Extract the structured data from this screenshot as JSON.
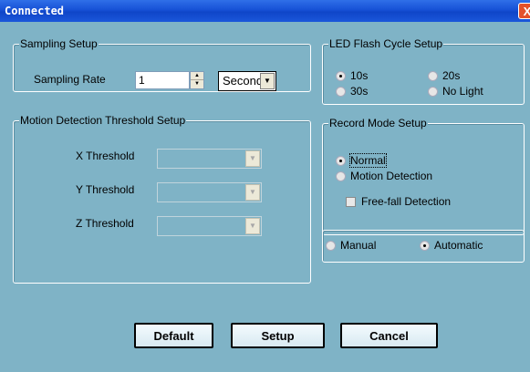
{
  "window": {
    "title": "Connected",
    "close_glyph": "X"
  },
  "sampling": {
    "legend": "Sampling Setup",
    "rate_label": "Sampling Rate",
    "rate_value": "1",
    "unit_value": "Second"
  },
  "led": {
    "legend": "LED Flash Cycle Setup",
    "options": [
      {
        "label": "10s",
        "selected": true
      },
      {
        "label": "20s",
        "selected": false
      },
      {
        "label": "30s",
        "selected": false
      },
      {
        "label": "No Light",
        "selected": false
      }
    ]
  },
  "motion": {
    "legend": "Motion Detection Threshold Setup",
    "x_label": "X Threshold",
    "y_label": "Y Threshold",
    "z_label": "Z Threshold"
  },
  "record": {
    "legend": "Record Mode Setup",
    "normal_label": "Normal",
    "motion_label": "Motion Detection",
    "freefall_label": "Free-fall Detection"
  },
  "mode": {
    "manual_label": "Manual",
    "automatic_label": "Automatic"
  },
  "buttons": {
    "default_label": "Default",
    "setup_label": "Setup",
    "cancel_label": "Cancel"
  }
}
